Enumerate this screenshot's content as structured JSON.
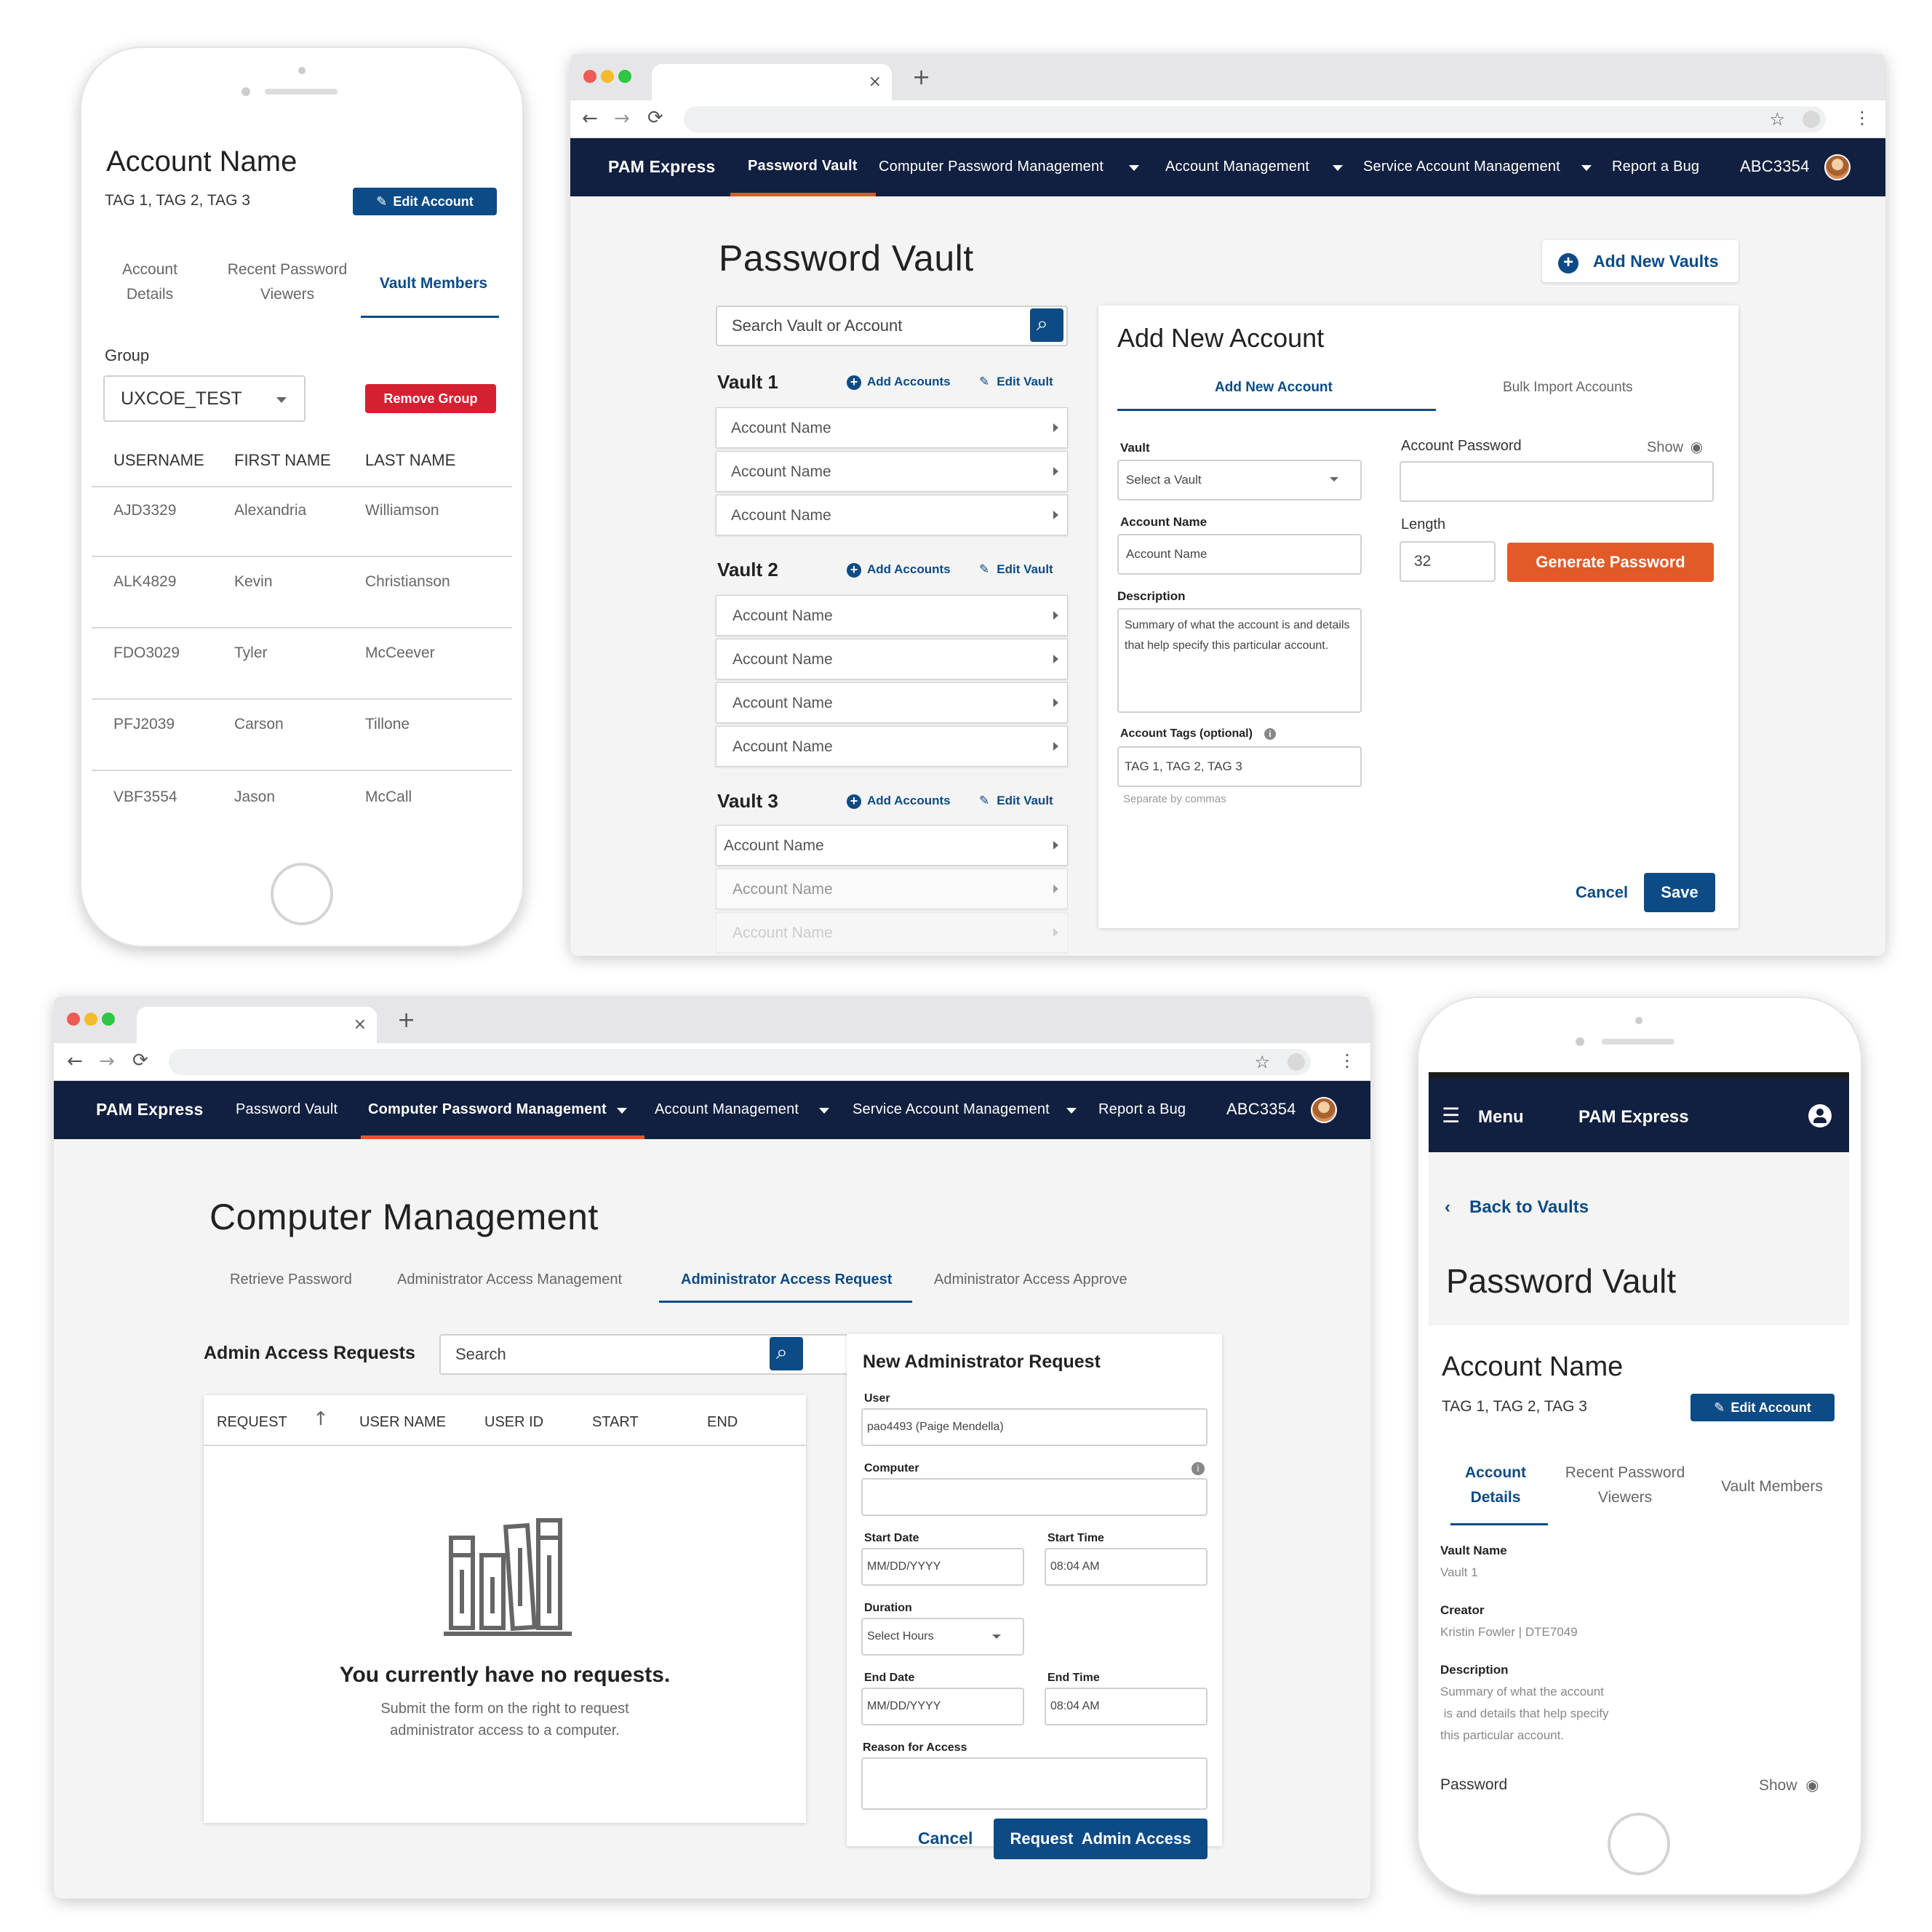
{
  "phone1": {
    "title": "Account Name",
    "tags": "TAG 1, TAG 2, TAG 3",
    "edit_button": "Edit Account",
    "tabs": [
      {
        "line1": "Account",
        "line2": "Details"
      },
      {
        "line1": "Recent Password",
        "line2": "Viewers"
      },
      {
        "line1": "Vault Members",
        "line2": ""
      }
    ],
    "group_label": "Group",
    "group_value": "UXCOE_TEST",
    "remove_button": "Remove Group",
    "columns": [
      "USERNAME",
      "FIRST NAME",
      "LAST NAME"
    ],
    "rows": [
      [
        "AJD3329",
        "Alexandria",
        "Williamson"
      ],
      [
        "ALK4829",
        "Kevin",
        "Christianson"
      ],
      [
        "FDO3029",
        "Tyler",
        "McCeever"
      ],
      [
        "PFJ2039",
        "Carson",
        "Tillone"
      ],
      [
        "VBF3554",
        "Jason",
        "McCall"
      ]
    ]
  },
  "nav": {
    "brand": "PAM Express",
    "items": [
      "Password Vault",
      "Computer Password Management",
      "Account Management",
      "Service Account Management",
      "Report a Bug"
    ],
    "user": "ABC3354"
  },
  "vault_page": {
    "title": "Password Vault",
    "add_vaults": "Add New Vaults",
    "search_placeholder": "Search Vault or Account",
    "add_accounts": "Add Accounts",
    "edit_vault": "Edit Vault",
    "vaults": [
      {
        "name": "Vault 1",
        "accounts": [
          "Account Name",
          "Account Name",
          "Account Name"
        ]
      },
      {
        "name": "Vault 2",
        "accounts": [
          "Account Name",
          "Account Name",
          "Account Name",
          "Account Name"
        ]
      },
      {
        "name": "Vault 3",
        "accounts": [
          "Account Name",
          "Account Name",
          "Account Name"
        ]
      }
    ],
    "form": {
      "title": "Add New Account",
      "tab_add": "Add New Account",
      "tab_bulk": "Bulk Import Accounts",
      "vault_label": "Vault",
      "vault_select": "Select a Vault",
      "account_label": "Account Name",
      "account_value": "Account Name",
      "desc_label": "Description",
      "desc_value": "Summary of what the account is and details that help specify this particular account.",
      "tags_label": "Account Tags (optional)",
      "tags_value": "TAG 1, TAG 2, TAG 3",
      "tags_hint": "Separate by commas",
      "pwd_label": "Account Password",
      "show": "Show",
      "length_label": "Length",
      "length_value": "32",
      "generate": "Generate Password",
      "cancel": "Cancel",
      "save": "Save"
    }
  },
  "computer_page": {
    "title": "Computer Management",
    "tabs": [
      "Retrieve Password",
      "Administrator Access Management",
      "Administrator Access Request",
      "Administrator Access Approve"
    ],
    "requests_title": "Admin Access Requests",
    "search_placeholder": "Search",
    "columns": [
      "REQUEST",
      "USER NAME",
      "USER ID",
      "START",
      "END"
    ],
    "empty_title": "You currently have no requests.",
    "empty_line1": "Submit the form on the right to request",
    "empty_line2": "administrator access to a computer.",
    "form": {
      "title": "New Administrator Request",
      "user_label": "User",
      "user_value": "pao4493 (Paige Mendella)",
      "computer_label": "Computer",
      "start_date_label": "Start Date",
      "start_date_value": "MM/DD/YYYY",
      "start_time_label": "Start Time",
      "start_time_value": "08:04 AM",
      "duration_label": "Duration",
      "duration_value": "Select Hours",
      "end_date_label": "End Date",
      "end_date_value": "MM/DD/YYYY",
      "end_time_label": "End Time",
      "end_time_value": "08:04 AM",
      "reason_label": "Reason for Access",
      "cancel": "Cancel",
      "submit": "Request  Admin Access"
    }
  },
  "phone2": {
    "menu": "Menu",
    "brand": "PAM Express",
    "back": "Back to Vaults",
    "title": "Password Vault",
    "account_title": "Account Name",
    "tags": "TAG 1, TAG 2, TAG 3",
    "edit_button": "Edit Account",
    "tabs": [
      {
        "line1": "Account",
        "line2": "Details"
      },
      {
        "line1": "Recent Password",
        "line2": "Viewers"
      },
      {
        "line1": "Vault Members",
        "line2": ""
      }
    ],
    "vault_name_label": "Vault Name",
    "vault_name_value": "Vault 1",
    "creator_label": "Creator",
    "creator_value": "Kristin Fowler | DTE7049",
    "desc_label": "Description",
    "desc_line1": "Summary of what the account",
    "desc_line2": " is and details that help specify",
    "desc_line3": "this particular account.",
    "password_label": "Password",
    "show": "Show"
  },
  "colors": {
    "navy": "#112040",
    "brand_blue": "#0d4b86",
    "orange": "#e25a27",
    "red": "#d42131"
  }
}
